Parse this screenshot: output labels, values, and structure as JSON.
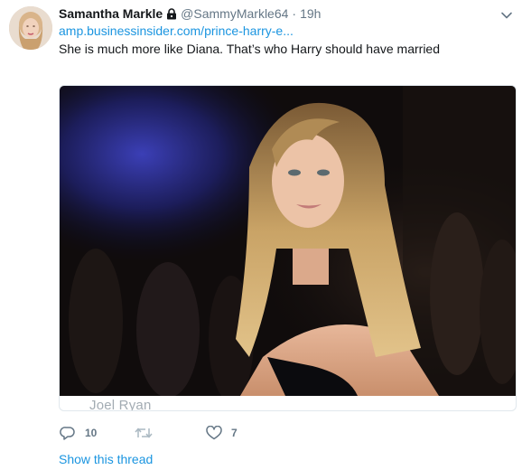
{
  "tweet": {
    "display_name": "Samantha Markle",
    "handle": "@SammyMarkle64",
    "separator": "·",
    "time": "19h",
    "link_text": "amp.businessinsider.com/prince-harry-e...",
    "text": "She is much more like Diana. That’s who Harry should have married"
  },
  "media": {
    "credit": "Joel Ryan"
  },
  "actions": {
    "reply_count": "10",
    "retweet_count": "",
    "like_count": "7"
  },
  "thread": {
    "show_label": "Show this thread"
  },
  "icons": {
    "lock": "lock-icon",
    "caret": "chevron-down-icon",
    "reply": "reply-icon",
    "retweet": "retweet-icon",
    "like": "heart-icon"
  },
  "colors": {
    "link": "#1b95e0",
    "secondary_text": "#657786",
    "primary_text": "#14171a"
  }
}
